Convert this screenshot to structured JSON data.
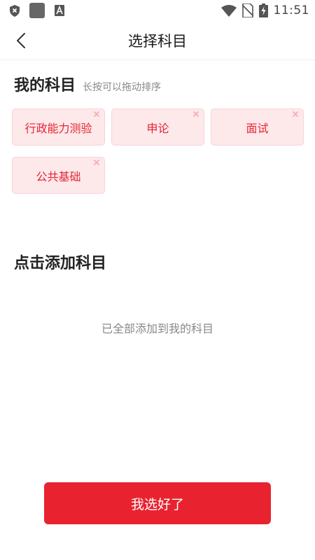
{
  "status_bar": {
    "time": "11:51",
    "left_icons": [
      "shield-x-icon",
      "app-square-icon",
      "font-a-icon"
    ],
    "right_icons": [
      "wifi-icon",
      "no-sim-icon",
      "battery-charging-icon"
    ]
  },
  "nav": {
    "title": "选择科目",
    "back_icon": "chevron-left-icon"
  },
  "my_subjects": {
    "title": "我的科目",
    "hint": "长按可以拖动排序",
    "items": [
      {
        "label": "行政能力测验"
      },
      {
        "label": "申论"
      },
      {
        "label": "面试"
      },
      {
        "label": "公共基础"
      }
    ]
  },
  "add_subjects": {
    "title": "点击添加科目",
    "empty_text": "已全部添加到我的科目"
  },
  "footer": {
    "done_label": "我选好了"
  },
  "colors": {
    "accent": "#e8232f",
    "chip_bg": "#fde8ea",
    "chip_text": "#e62532"
  }
}
